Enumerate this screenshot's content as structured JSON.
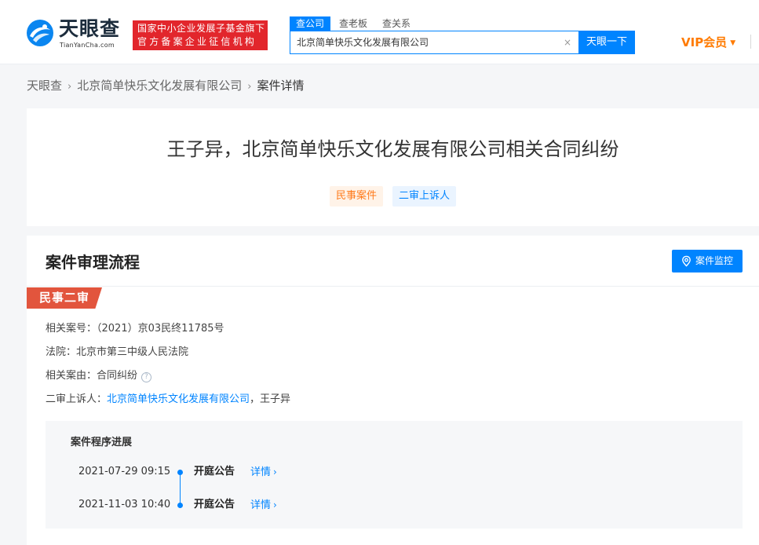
{
  "header": {
    "logo_text": "天眼查",
    "logo_sub": "TianYanCha.com",
    "slogan_line1": "国家中小企业发展子基金旗下",
    "slogan_line2": "官方备案企业征信机构",
    "search_tabs": [
      {
        "label": "查公司",
        "active": true
      },
      {
        "label": "查老板",
        "active": false
      },
      {
        "label": "查关系",
        "active": false
      }
    ],
    "search_value": "北京简单快乐文化发展有限公司",
    "clear_icon": "×",
    "search_button": "天眼一下",
    "vip_label": "VIP会员",
    "vip_caret": "▼",
    "colors": {
      "brand_blue": "#0084ff",
      "brand_red": "#e2262c",
      "vip_orange": "#ff7b00"
    }
  },
  "breadcrumb": {
    "items": [
      "天眼查",
      "北京简单快乐文化发展有限公司"
    ],
    "current": "案件详情",
    "separator": "›"
  },
  "case": {
    "title": "王子异，北京简单快乐文化发展有限公司相关合同纠纷",
    "tags": [
      {
        "label": "民事案件",
        "color": "orange"
      },
      {
        "label": "二审上诉人",
        "color": "blue"
      }
    ]
  },
  "process": {
    "title": "案件审理流程",
    "monitor_button": "案件监控",
    "monitor_icon": "location-pin-icon",
    "stage": "民事二审",
    "info": {
      "case_no_label": "相关案号：",
      "case_no": "（2021）京03民终11785号",
      "court_label": "法院：",
      "court": "北京市第三中级人民法院",
      "cause_label": "相关案由：",
      "cause": "合同纠纷",
      "help_icon": "?",
      "appellant_label": "二审上诉人：",
      "appellant_company": "北京简单快乐文化发展有限公司",
      "appellant_rest": "，王子异"
    },
    "progress": {
      "title": "案件程序进展",
      "items": [
        {
          "time": "2021-07-29 09:15",
          "type": "开庭公告",
          "detail": "详情"
        },
        {
          "time": "2021-11-03 10:40",
          "type": "开庭公告",
          "detail": "详情"
        }
      ],
      "chevron": "›"
    }
  }
}
